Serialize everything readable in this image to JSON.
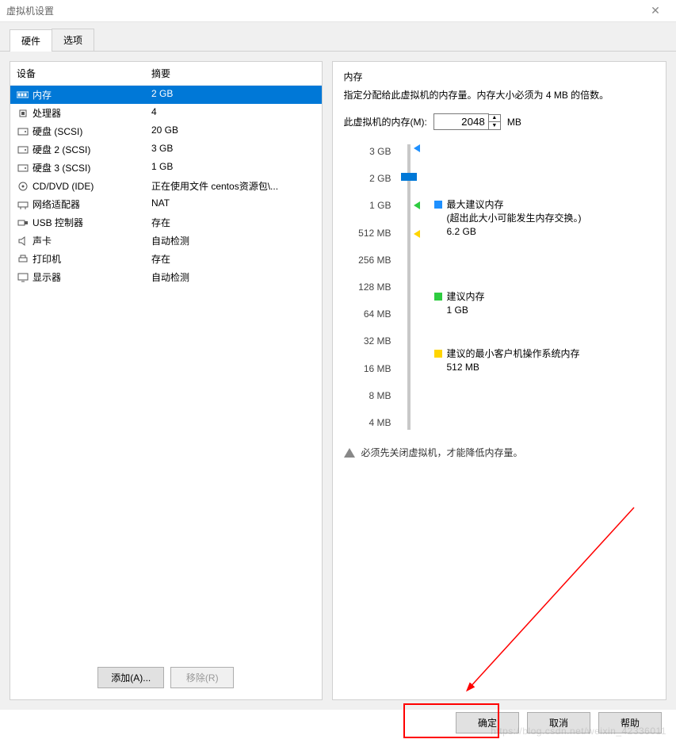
{
  "window": {
    "title": "虚拟机设置"
  },
  "tabs": {
    "hardware": "硬件",
    "options": "选项"
  },
  "hw_header": {
    "device": "设备",
    "summary": "摘要"
  },
  "hw_rows": [
    {
      "icon": "memory-icon",
      "name": "内存",
      "summary": "2 GB",
      "selected": true
    },
    {
      "icon": "cpu-icon",
      "name": "处理器",
      "summary": "4"
    },
    {
      "icon": "disk-icon",
      "name": "硬盘 (SCSI)",
      "summary": "20 GB"
    },
    {
      "icon": "disk-icon",
      "name": "硬盘 2 (SCSI)",
      "summary": "3 GB"
    },
    {
      "icon": "disk-icon",
      "name": "硬盘 3 (SCSI)",
      "summary": "1 GB"
    },
    {
      "icon": "cd-icon",
      "name": "CD/DVD (IDE)",
      "summary": "正在使用文件 centos资源包\\..."
    },
    {
      "icon": "net-icon",
      "name": "网络适配器",
      "summary": "NAT"
    },
    {
      "icon": "usb-icon",
      "name": "USB 控制器",
      "summary": "存在"
    },
    {
      "icon": "sound-icon",
      "name": "声卡",
      "summary": "自动检测"
    },
    {
      "icon": "printer-icon",
      "name": "打印机",
      "summary": "存在"
    },
    {
      "icon": "display-icon",
      "name": "显示器",
      "summary": "自动检测"
    }
  ],
  "hw_buttons": {
    "add": "添加(A)...",
    "remove": "移除(R)"
  },
  "memory": {
    "title": "内存",
    "desc": "指定分配给此虚拟机的内存量。内存大小必须为 4 MB 的倍数。",
    "label": "此虚拟机的内存(M):",
    "value": "2048",
    "unit": "MB",
    "ticks": [
      "3 GB",
      "2 GB",
      "1 GB",
      "512 MB",
      "256 MB",
      "128 MB",
      "64 MB",
      "32 MB",
      "16 MB",
      "8 MB",
      "4 MB"
    ],
    "max_rec_label": "最大建议内存",
    "max_rec_note": "(超出此大小可能发生内存交换。)",
    "max_rec_value": "6.2 GB",
    "rec_label": "建议内存",
    "rec_value": "1 GB",
    "min_label": "建议的最小客户机操作系统内存",
    "min_value": "512 MB",
    "warning": "必须先关闭虚拟机，才能降低内存量。"
  },
  "footer": {
    "ok": "确定",
    "cancel": "取消",
    "help": "帮助"
  },
  "watermark": "https://blog.csdn.net/weixin_42336011"
}
